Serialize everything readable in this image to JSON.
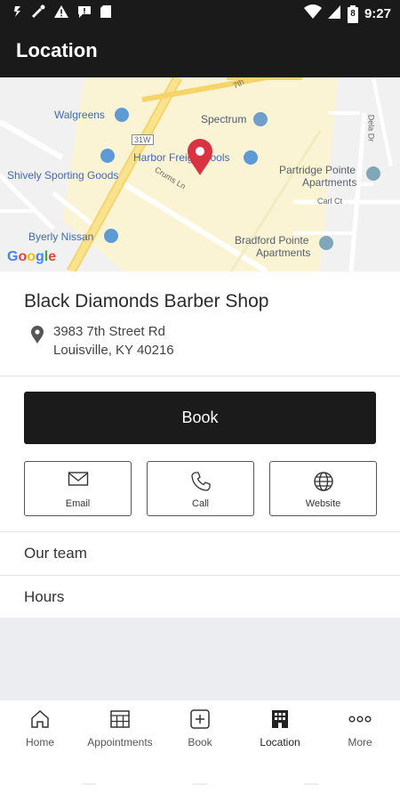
{
  "status_bar": {
    "time": "9:27",
    "battery_level": "8"
  },
  "app_bar": {
    "title": "Location"
  },
  "map": {
    "labels": {
      "walgreens": "Walgreens",
      "spectrum": "Spectrum",
      "harbor": "Harbor Freight Tools",
      "shively": "Shively Sporting Goods",
      "partridge1": "Partridge Pointe",
      "partridge2": "Apartments",
      "byerly": "Byerly Nissan",
      "bradford1": "Bradford Pointe",
      "bradford2": "Apartments",
      "road_7th": "7th",
      "crums": "Crums Ln",
      "carl": "Carl Ct",
      "dela": "Dela Dr",
      "shield": "31W",
      "google": "Google"
    },
    "pin_color": "#d93240",
    "poi_color": "#5c9bd6"
  },
  "shop": {
    "name": "Black Diamonds Barber Shop",
    "address_line1": "3983 7th Street Rd",
    "address_line2": "Louisville, KY 40216"
  },
  "book_label": "Book",
  "actions": [
    {
      "label": "Email",
      "icon": "envelope-icon"
    },
    {
      "label": "Call",
      "icon": "phone-icon"
    },
    {
      "label": "Website",
      "icon": "globe-icon"
    }
  ],
  "rows": [
    {
      "label": "Our team"
    },
    {
      "label": "Hours"
    }
  ],
  "tabs": [
    {
      "label": "Home",
      "icon": "home-icon"
    },
    {
      "label": "Appointments",
      "icon": "calendar-icon"
    },
    {
      "label": "Book",
      "icon": "plus-box-icon"
    },
    {
      "label": "Location",
      "icon": "building-icon"
    },
    {
      "label": "More",
      "icon": "more-dots-icon"
    }
  ]
}
